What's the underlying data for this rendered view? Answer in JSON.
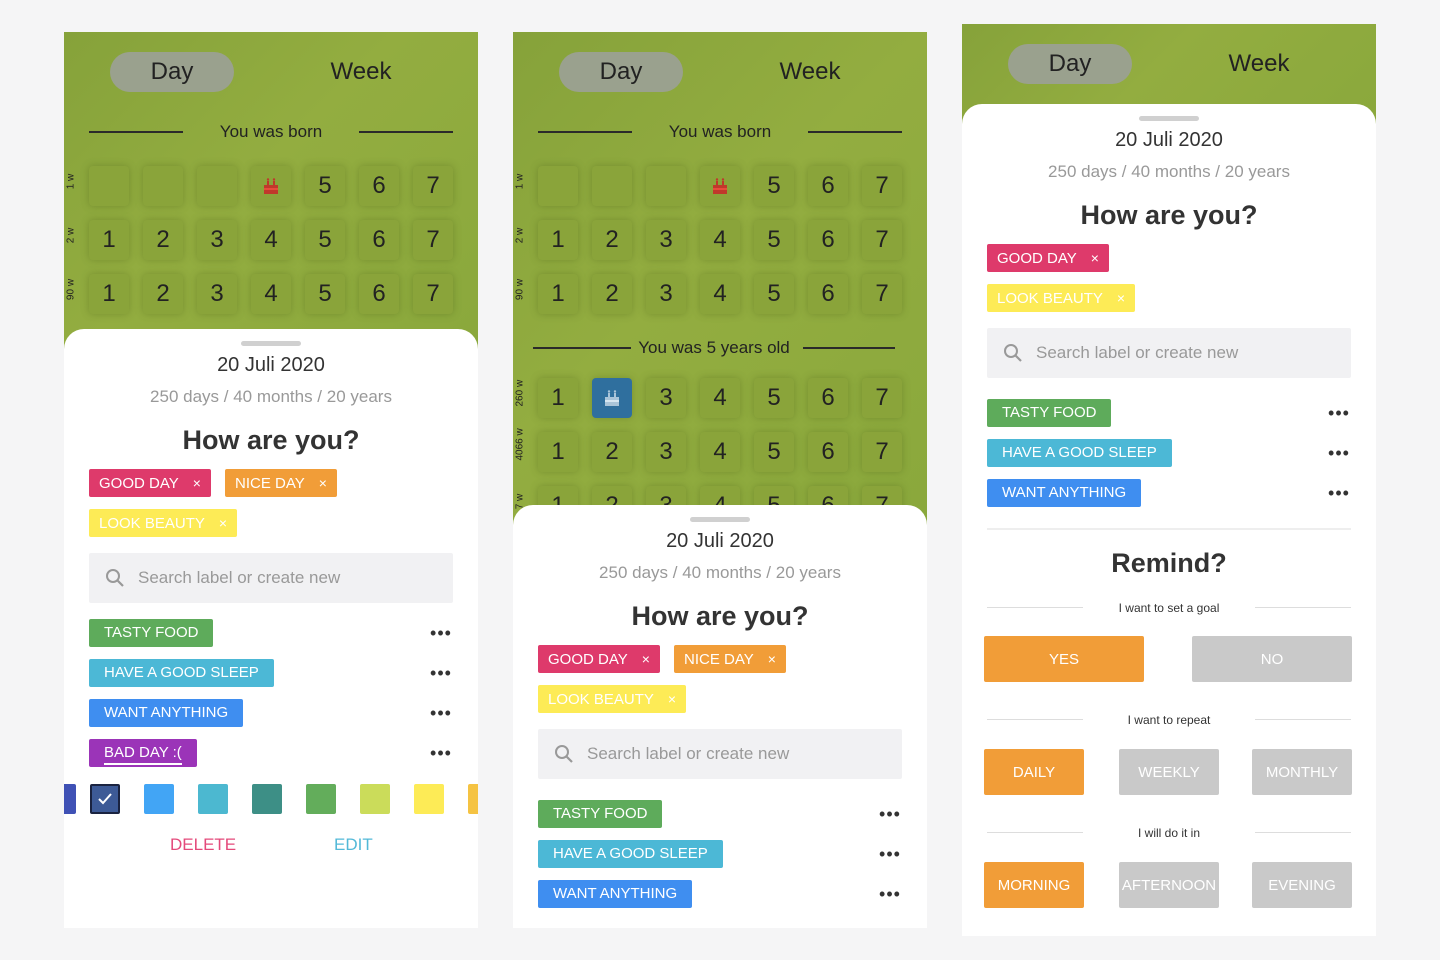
{
  "toggle": {
    "day": "Day",
    "week": "Week"
  },
  "sections": {
    "born": "You was born",
    "five": "You was 5 years old"
  },
  "rows": {
    "w1": "1 w",
    "w2": "2 w",
    "w90": "90 w",
    "w260": "260 w",
    "w4066": "4066 w",
    "w_cut": "7 w"
  },
  "nums": [
    "1",
    "2",
    "3",
    "4",
    "5",
    "6",
    "7"
  ],
  "sheet": {
    "date": "20 Juli 2020",
    "meta": "250 days / 40 months / 20 years",
    "question": "How are you?",
    "search_placeholder": "Search label or create new",
    "close": "×",
    "more": "•••"
  },
  "selected": {
    "good_day": "GOOD DAY",
    "nice_day": "NICE DAY",
    "look_beauty": "LOOK BEAUTY"
  },
  "labels": {
    "tasty_food": "TASTY FOOD",
    "good_sleep": "HAVE A GOOD SLEEP",
    "want_anything": "WANT ANYTHING",
    "bad_day": "BAD DAY :("
  },
  "actions": {
    "delete": "DELETE",
    "edit": "EDIT"
  },
  "palette": [
    "#3f51b5",
    "#3d5a96",
    "#42a5f5",
    "#4cb8d0",
    "#3d8f86",
    "#63ad5b",
    "#cbdc5a",
    "#fdeb56",
    "#f5c343",
    "#f19d3a",
    "#ea6138"
  ],
  "colors": {
    "pink": "#de3a6b",
    "orange": "#f19d38",
    "yellow": "#fdeb56",
    "green": "#5eab5b",
    "teal": "#4cb8d6",
    "blue": "#3f8ef0",
    "purple": "#9b34b8",
    "grey": "#c9c9c9",
    "delete": "#e44a7b",
    "edit": "#53b9d8"
  },
  "remind": {
    "title": "Remind?",
    "goal": "I want to set a goal",
    "yes": "YES",
    "no": "NO",
    "repeat": "I want to repeat",
    "daily": "DAILY",
    "weekly": "WEEKLY",
    "monthly": "MONTHLY",
    "when": "I will do it in",
    "morning": "MORNING",
    "afternoon": "AFTERNOON",
    "evening": "EVENING"
  }
}
